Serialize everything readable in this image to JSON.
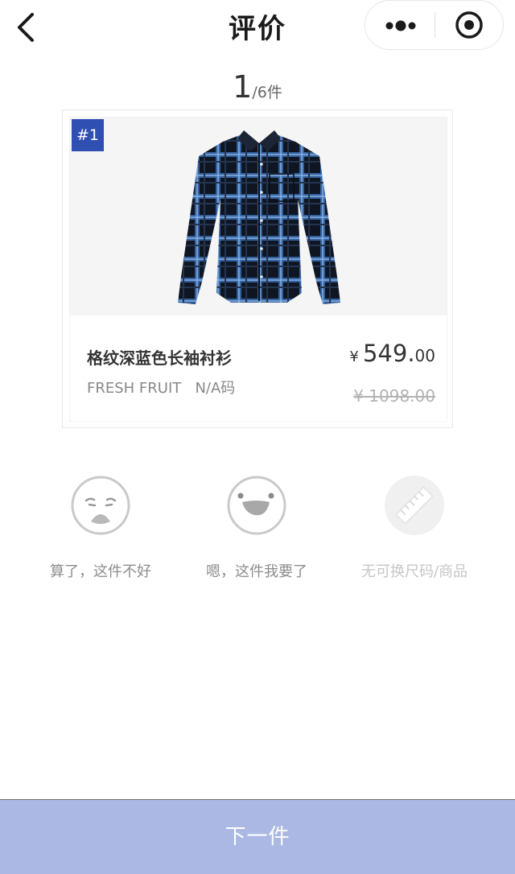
{
  "header": {
    "title": "评价",
    "back_icon": "chevron-left-icon",
    "more_icon": "more-dots-icon",
    "close_icon": "target-circle-icon"
  },
  "counter": {
    "current": "1",
    "total": "/6件"
  },
  "product": {
    "badge": "#1",
    "name": "格纹深蓝色长袖衬衫",
    "brand": "FRESH FRUIT",
    "size": "N/A码",
    "currency": "¥",
    "price_int": "549.",
    "price_dec": "00",
    "original_price": "¥ 1098.00",
    "image_icon": "plaid-shirt-image"
  },
  "options": [
    {
      "label": "算了，这件不好",
      "icon": "sad-face-icon"
    },
    {
      "label": "嗯，这件我要了",
      "icon": "happy-face-icon"
    },
    {
      "label": "无可换尺码/商品",
      "icon": "ruler-icon"
    }
  ],
  "next_button": {
    "label": "下一件"
  },
  "colors": {
    "badge": "#2f4fb3",
    "next_button_bg": "#abb8e3",
    "text_primary": "#333333",
    "text_muted": "#8c8c8c"
  }
}
